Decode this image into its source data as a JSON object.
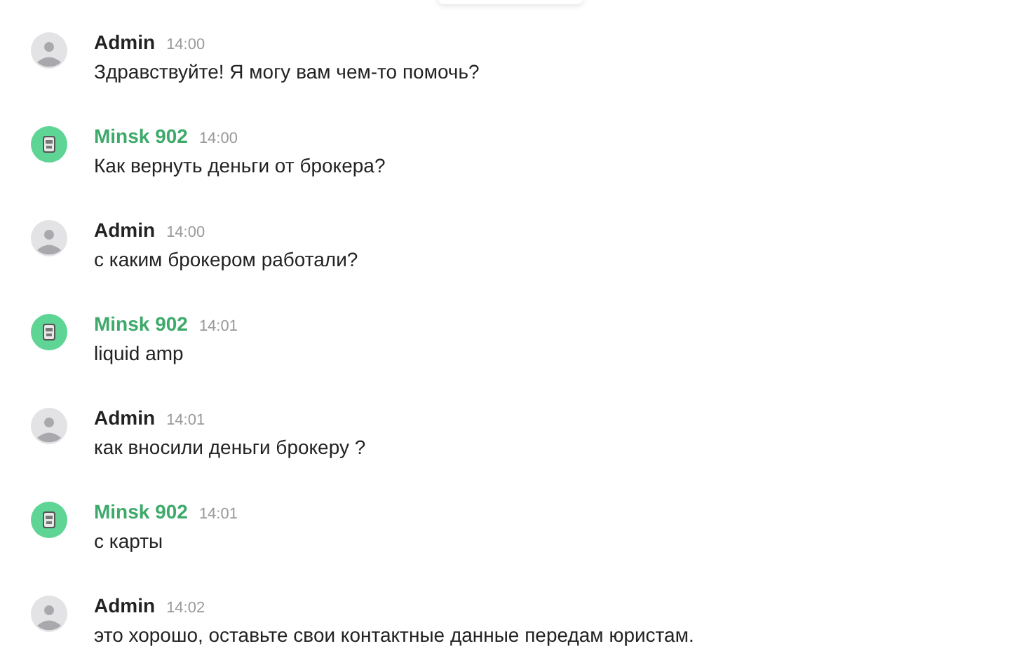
{
  "messages": [
    {
      "kind": "admin",
      "author": "Admin",
      "time": "14:00",
      "text": "Здравствуйте! Я могу вам чем-то помочь?"
    },
    {
      "kind": "user",
      "author": "Minsk 902",
      "time": "14:00",
      "text": "Как вернуть деньги от брокера?"
    },
    {
      "kind": "admin",
      "author": "Admin",
      "time": "14:00",
      "text": "с каким брокером работали?"
    },
    {
      "kind": "user",
      "author": "Minsk 902",
      "time": "14:01",
      "text": "liquid amp"
    },
    {
      "kind": "admin",
      "author": "Admin",
      "time": "14:01",
      "text": "как вносили деньги брокеру ?"
    },
    {
      "kind": "user",
      "author": "Minsk 902",
      "time": "14:01",
      "text": "с карты"
    },
    {
      "kind": "admin",
      "author": "Admin",
      "time": "14:02",
      "text": "это хорошо, оставьте свои контактные данные передам юристам."
    }
  ]
}
